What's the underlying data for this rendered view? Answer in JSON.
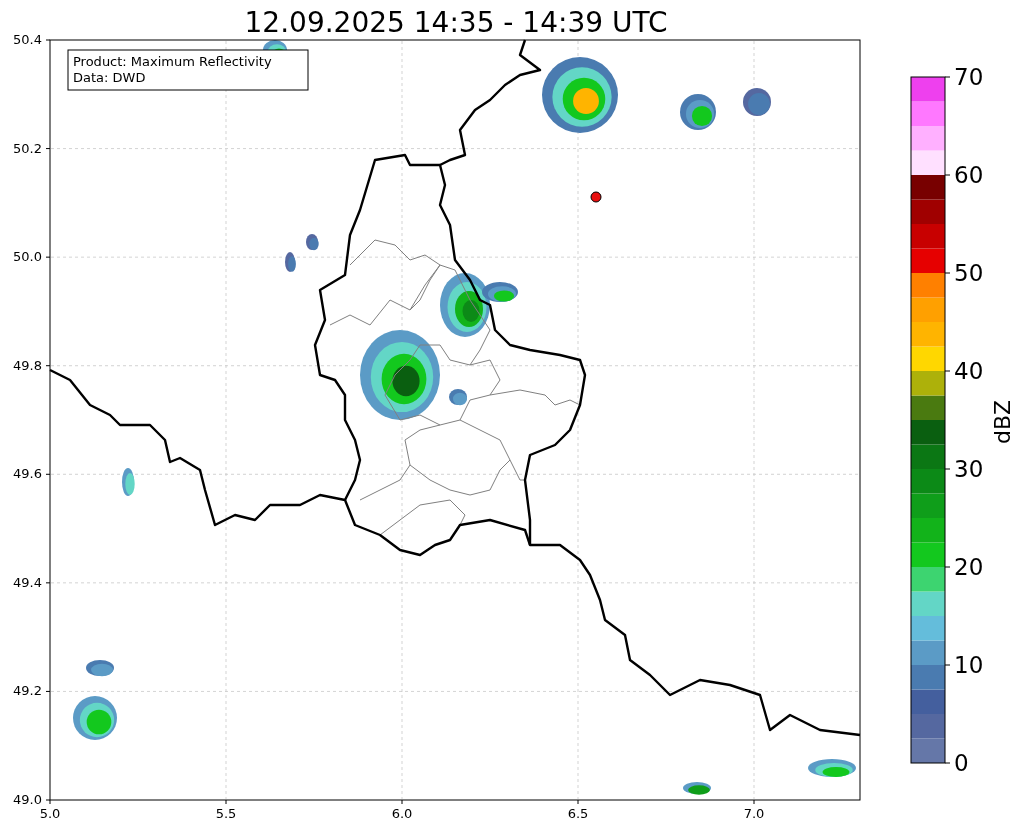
{
  "title": "12.09.2025 14:35 - 14:39 UTC",
  "map": {
    "xticks": [
      "5.0",
      "5.5",
      "6.0",
      "6.5",
      "7.0"
    ],
    "yticks": [
      "50.4",
      "50.2",
      "50.0",
      "49.8",
      "49.6",
      "49.4",
      "49.2",
      "49.0"
    ],
    "info_box": [
      "Product: Maximum Reflectivity",
      "Data: DWD"
    ]
  },
  "colorbar": {
    "label": "dBZ",
    "ticks": [
      "70",
      "60",
      "50",
      "40",
      "30",
      "20",
      "10",
      "0"
    ],
    "bands": [
      {
        "color": "#6577a8"
      },
      {
        "color": "#5568a0"
      },
      {
        "color": "#445f9e"
      },
      {
        "color": "#4a7bb0"
      },
      {
        "color": "#5b9bc6"
      },
      {
        "color": "#64bddb"
      },
      {
        "color": "#63d6c6"
      },
      {
        "color": "#3dd470"
      },
      {
        "color": "#13c81e"
      },
      {
        "color": "#12b31a"
      },
      {
        "color": "#0f9e1a"
      },
      {
        "color": "#0c8a17"
      },
      {
        "color": "#0b7714"
      },
      {
        "color": "#0a5f10"
      },
      {
        "color": "#4a7a10"
      },
      {
        "color": "#adb10a"
      },
      {
        "color": "#ffd700"
      },
      {
        "color": "#ffb400"
      },
      {
        "color": "#ffa000"
      },
      {
        "color": "#ff8000"
      },
      {
        "color": "#e60000"
      },
      {
        "color": "#c80000"
      },
      {
        "color": "#a00000"
      },
      {
        "color": "#780000"
      },
      {
        "color": "#ffe0ff"
      },
      {
        "color": "#ffb0ff"
      },
      {
        "color": "#ff78ff"
      },
      {
        "color": "#ee40ee"
      }
    ]
  }
}
